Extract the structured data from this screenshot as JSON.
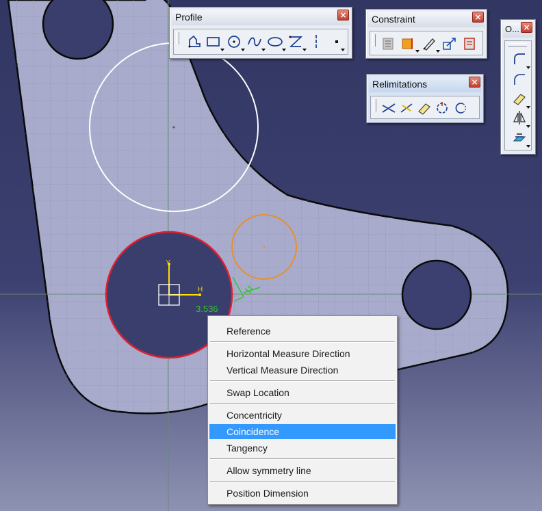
{
  "viewport": {
    "background_top": "#323662",
    "background_bottom": "#8e92b2"
  },
  "sketch": {
    "part_fill": "#a8abcb",
    "dimension_value": "3.536",
    "axis_h_label": "H",
    "axis_v_label": "V",
    "selected_circle_color": "#e02030",
    "preview_circle_color": "#e8902c",
    "construction_circle_color": "#ffffff",
    "dimension_color": "#2fc82f",
    "axis_color": "#ffe000"
  },
  "toolbars": {
    "profile": {
      "title": "Profile",
      "close_label": "×",
      "tools": [
        "profile-icon",
        "rectangle-icon",
        "circle-icon",
        "spline-icon",
        "ellipse-icon",
        "line-icon",
        "axis-icon",
        "point-icon"
      ]
    },
    "constraint": {
      "title": "Constraint",
      "close_label": "×",
      "tools": [
        "constraint-dialog-icon",
        "constraint-icon",
        "auto-constraint-icon",
        "animate-constraint-icon",
        "edit-multi-constraint-icon"
      ]
    },
    "relimitations": {
      "title": "Relimitations",
      "close_label": "×",
      "tools": [
        "trim-icon",
        "break-icon",
        "quick-trim-icon",
        "close-arc-icon",
        "complement-icon"
      ]
    },
    "operation": {
      "title": "O...",
      "close_label": "×",
      "tools": [
        "corner-icon",
        "chamfer-icon",
        "relimit-icon",
        "mirror-icon",
        "project-3d-icon"
      ]
    }
  },
  "context_menu": {
    "items": [
      {
        "label": "Reference",
        "selected": false
      },
      {
        "label": "Horizontal Measure Direction",
        "selected": false
      },
      {
        "label": "Vertical Measure Direction",
        "selected": false
      },
      {
        "label": "Swap Location",
        "selected": false
      },
      {
        "label": "Concentricity",
        "selected": false
      },
      {
        "label": "Coincidence",
        "selected": true
      },
      {
        "label": "Tangency",
        "selected": false
      },
      {
        "label": "Allow symmetry line",
        "selected": false
      },
      {
        "label": "Position Dimension",
        "selected": false
      }
    ],
    "highlight_color": "#3399ff"
  }
}
